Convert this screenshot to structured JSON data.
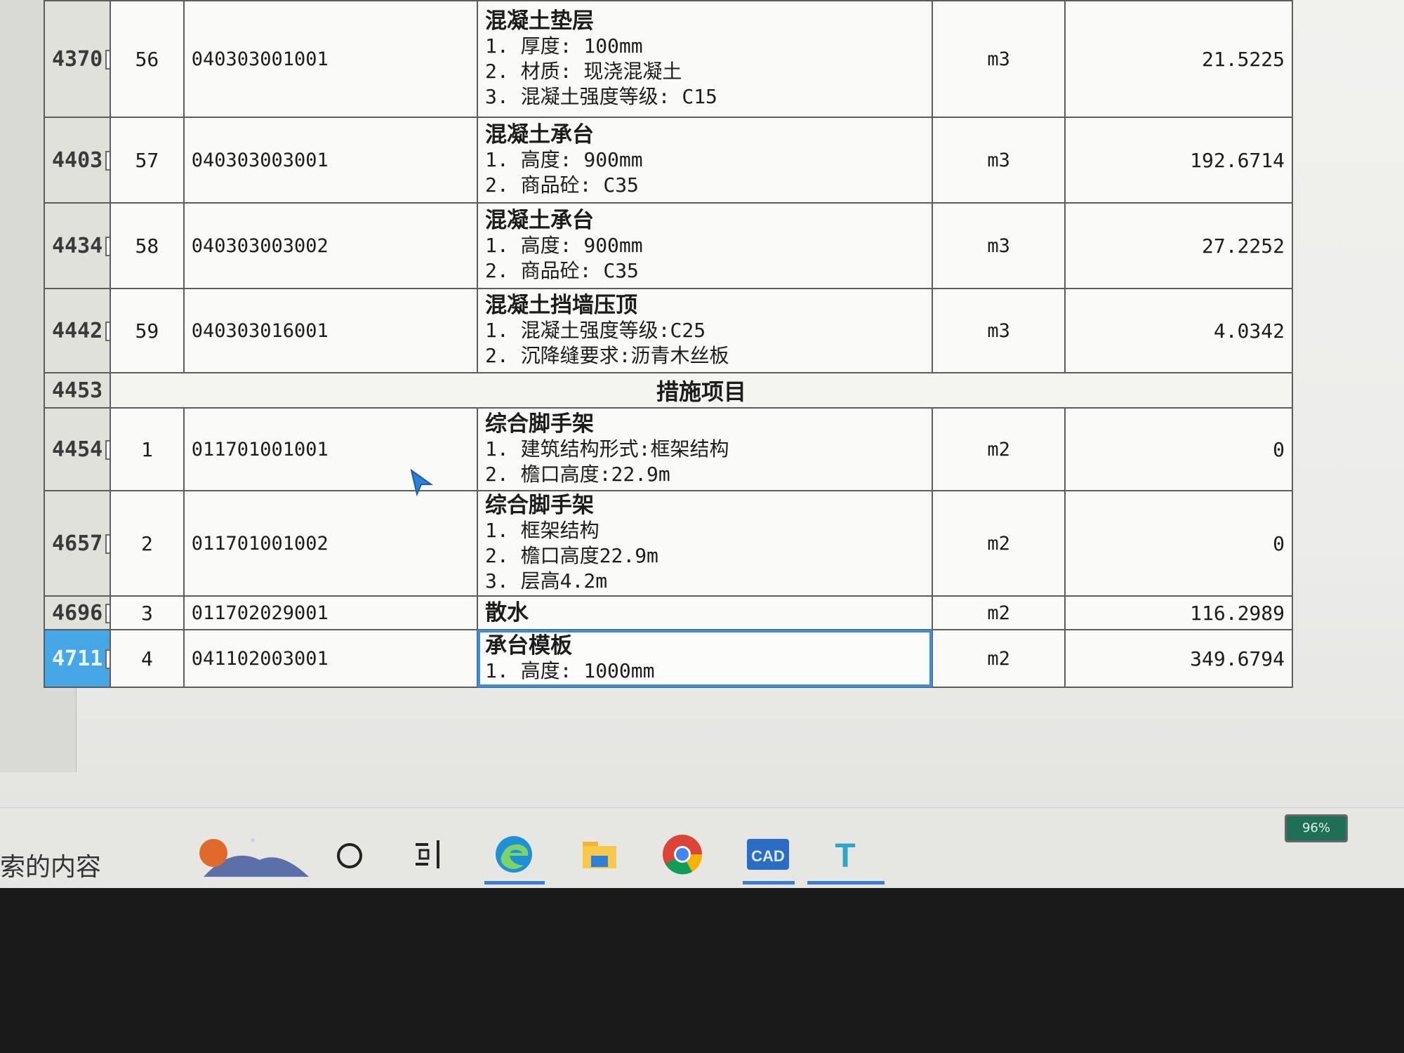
{
  "table": {
    "rows": [
      {
        "row_no": "4370",
        "seq": "56",
        "code": "040303001001",
        "title": "混凝土垫层",
        "lines": [
          "1. 厚度: 100mm",
          "2. 材质: 现浇混凝土",
          "3. 混凝土强度等级: C15"
        ],
        "unit": "m3",
        "quantity": "21.5225"
      },
      {
        "row_no": "4403",
        "seq": "57",
        "code": "040303003001",
        "title": "混凝土承台",
        "lines": [
          "1. 高度: 900mm",
          "2. 商品砼: C35"
        ],
        "unit": "m3",
        "quantity": "192.6714"
      },
      {
        "row_no": "4434",
        "seq": "58",
        "code": "040303003002",
        "title": "混凝土承台",
        "lines": [
          "1. 高度: 900mm",
          "2. 商品砼: C35"
        ],
        "unit": "m3",
        "quantity": "27.2252"
      },
      {
        "row_no": "4442",
        "seq": "59",
        "code": "040303016001",
        "title": "混凝土挡墙压顶",
        "lines": [
          "1. 混凝土强度等级:C25",
          "2. 沉降缝要求:沥青木丝板"
        ],
        "unit": "m3",
        "quantity": "4.0342"
      }
    ],
    "section": {
      "row_no": "4453",
      "label": "措施项目"
    },
    "rows2": [
      {
        "row_no": "4454",
        "seq": "1",
        "code": "011701001001",
        "title": "综合脚手架",
        "lines": [
          "1. 建筑结构形式:框架结构",
          "2. 檐口高度:22.9m"
        ],
        "unit": "m2",
        "quantity": "0"
      },
      {
        "row_no": "4657",
        "seq": "2",
        "code": "011701001002",
        "title": "综合脚手架",
        "lines": [
          "1. 框架结构",
          "2. 檐口高度22.9m",
          "3. 层高4.2m"
        ],
        "unit": "m2",
        "quantity": "0"
      },
      {
        "row_no": "4696",
        "seq": "3",
        "code": "011702029001",
        "title": "散水",
        "lines": [],
        "unit": "m2",
        "quantity": "116.2989"
      },
      {
        "row_no": "4711",
        "seq": "4",
        "code": "041102003001",
        "title": "承台模板",
        "lines": [
          "1. 高度: 1000mm"
        ],
        "unit": "m2",
        "quantity": "349.6794"
      }
    ],
    "expand_glyph": "+"
  },
  "taskbar": {
    "search_text": "索的内容",
    "icons": [
      "weather-icon",
      "cortana-circle-icon",
      "task-view-icon",
      "edge-icon",
      "file-explorer-icon",
      "chrome-icon",
      "cad-icon",
      "t-app-icon"
    ],
    "cad_label": "CAD",
    "t_label": "T",
    "battery_label": "96%"
  },
  "colors": {
    "selection": "#47a7e6",
    "grid_line": "#5d5d5d"
  }
}
